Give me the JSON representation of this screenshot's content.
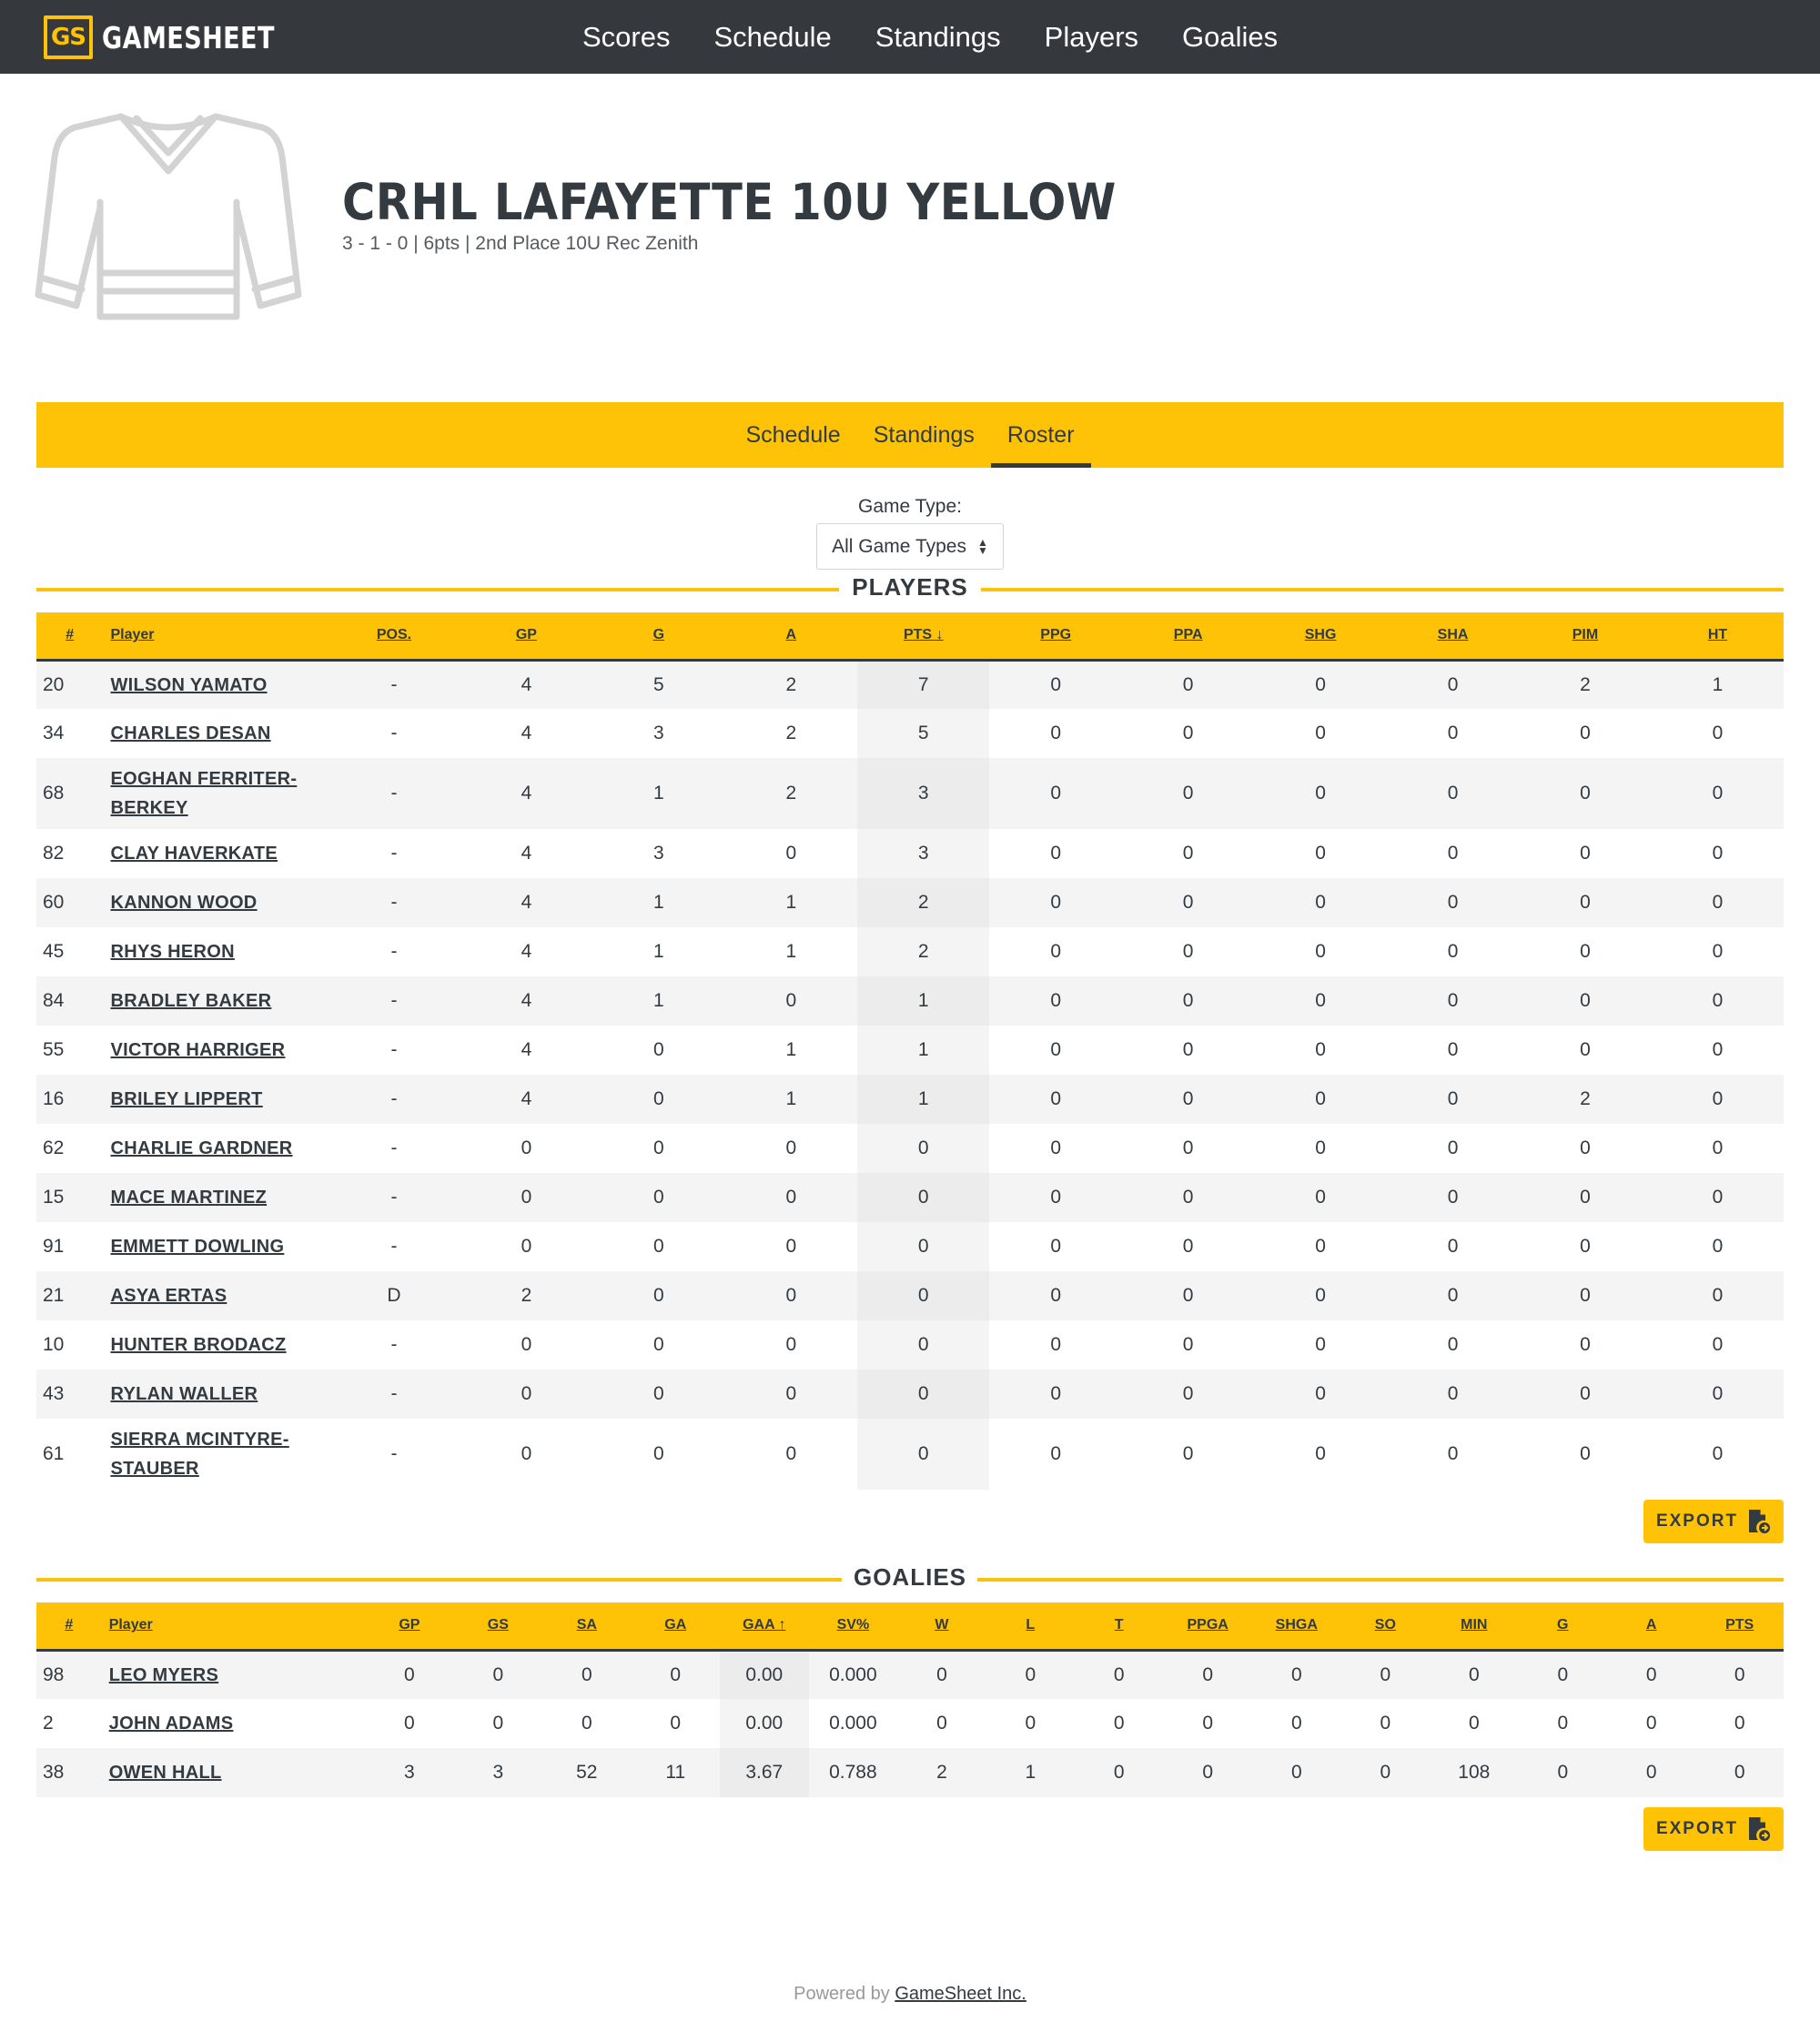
{
  "brand": {
    "logo_mark": "GS",
    "name": "GAMESHEET",
    "accent": "#fec307",
    "dark": "#35383d"
  },
  "topnav": [
    "Scores",
    "Schedule",
    "Standings",
    "Players",
    "Goalies"
  ],
  "team": {
    "name": "CRHL LAFAYETTE 10U YELLOW",
    "summary": "3 - 1 - 0 | 6pts | 2nd Place 10U Rec Zenith"
  },
  "tabs": [
    "Schedule",
    "Standings",
    "Roster"
  ],
  "active_tab": "Roster",
  "game_type": {
    "label": "Game Type:",
    "selected": "All Game Types"
  },
  "players": {
    "heading": "PLAYERS",
    "columns": [
      "#",
      "Player",
      "POS.",
      "GP",
      "G",
      "A",
      "PTS ↓",
      "PPG",
      "PPA",
      "SHG",
      "SHA",
      "PIM",
      "HT"
    ],
    "rows": [
      [
        "20",
        [
          "WILSON YAMATO"
        ],
        "-",
        "4",
        "5",
        "2",
        "7",
        "0",
        "0",
        "0",
        "0",
        "2",
        "1"
      ],
      [
        "34",
        [
          "CHARLES DESAN"
        ],
        "-",
        "4",
        "3",
        "2",
        "5",
        "0",
        "0",
        "0",
        "0",
        "0",
        "0"
      ],
      [
        "68",
        [
          "EOGHAN FERRITER-",
          "BERKEY"
        ],
        "-",
        "4",
        "1",
        "2",
        "3",
        "0",
        "0",
        "0",
        "0",
        "0",
        "0"
      ],
      [
        "82",
        [
          "CLAY HAVERKATE"
        ],
        "-",
        "4",
        "3",
        "0",
        "3",
        "0",
        "0",
        "0",
        "0",
        "0",
        "0"
      ],
      [
        "60",
        [
          "KANNON WOOD"
        ],
        "-",
        "4",
        "1",
        "1",
        "2",
        "0",
        "0",
        "0",
        "0",
        "0",
        "0"
      ],
      [
        "45",
        [
          "RHYS HERON"
        ],
        "-",
        "4",
        "1",
        "1",
        "2",
        "0",
        "0",
        "0",
        "0",
        "0",
        "0"
      ],
      [
        "84",
        [
          "BRADLEY BAKER"
        ],
        "-",
        "4",
        "1",
        "0",
        "1",
        "0",
        "0",
        "0",
        "0",
        "0",
        "0"
      ],
      [
        "55",
        [
          "VICTOR HARRIGER"
        ],
        "-",
        "4",
        "0",
        "1",
        "1",
        "0",
        "0",
        "0",
        "0",
        "0",
        "0"
      ],
      [
        "16",
        [
          "BRILEY LIPPERT"
        ],
        "-",
        "4",
        "0",
        "1",
        "1",
        "0",
        "0",
        "0",
        "0",
        "2",
        "0"
      ],
      [
        "62",
        [
          "CHARLIE GARDNER"
        ],
        "-",
        "0",
        "0",
        "0",
        "0",
        "0",
        "0",
        "0",
        "0",
        "0",
        "0"
      ],
      [
        "15",
        [
          "MACE MARTINEZ"
        ],
        "-",
        "0",
        "0",
        "0",
        "0",
        "0",
        "0",
        "0",
        "0",
        "0",
        "0"
      ],
      [
        "91",
        [
          "EMMETT DOWLING"
        ],
        "-",
        "0",
        "0",
        "0",
        "0",
        "0",
        "0",
        "0",
        "0",
        "0",
        "0"
      ],
      [
        "21",
        [
          "ASYA ERTAS"
        ],
        "D",
        "2",
        "0",
        "0",
        "0",
        "0",
        "0",
        "0",
        "0",
        "0",
        "0"
      ],
      [
        "10",
        [
          "HUNTER BRODACZ"
        ],
        "-",
        "0",
        "0",
        "0",
        "0",
        "0",
        "0",
        "0",
        "0",
        "0",
        "0"
      ],
      [
        "43",
        [
          "RYLAN WALLER"
        ],
        "-",
        "0",
        "0",
        "0",
        "0",
        "0",
        "0",
        "0",
        "0",
        "0",
        "0"
      ],
      [
        "61",
        [
          "SIERRA MCINTYRE-",
          "STAUBER"
        ],
        "-",
        "0",
        "0",
        "0",
        "0",
        "0",
        "0",
        "0",
        "0",
        "0",
        "0"
      ]
    ]
  },
  "goalies": {
    "heading": "GOALIES",
    "columns": [
      "#",
      "Player",
      "GP",
      "GS",
      "SA",
      "GA",
      "GAA ↑",
      "SV%",
      "W",
      "L",
      "T",
      "PPGA",
      "SHGA",
      "SO",
      "MIN",
      "G",
      "A",
      "PTS"
    ],
    "rows": [
      [
        "98",
        [
          "LEO MYERS"
        ],
        "0",
        "0",
        "0",
        "0",
        "0.00",
        "0.000",
        "0",
        "0",
        "0",
        "0",
        "0",
        "0",
        "0",
        "0",
        "0",
        "0"
      ],
      [
        "2",
        [
          "JOHN ADAMS"
        ],
        "0",
        "0",
        "0",
        "0",
        "0.00",
        "0.000",
        "0",
        "0",
        "0",
        "0",
        "0",
        "0",
        "0",
        "0",
        "0",
        "0"
      ],
      [
        "38",
        [
          "OWEN HALL"
        ],
        "3",
        "3",
        "52",
        "11",
        "3.67",
        "0.788",
        "2",
        "1",
        "0",
        "0",
        "0",
        "0",
        "108",
        "0",
        "0",
        "0"
      ]
    ]
  },
  "export_label": "EXPORT",
  "footer": {
    "prefix": "Powered by ",
    "link": "GameSheet Inc."
  }
}
